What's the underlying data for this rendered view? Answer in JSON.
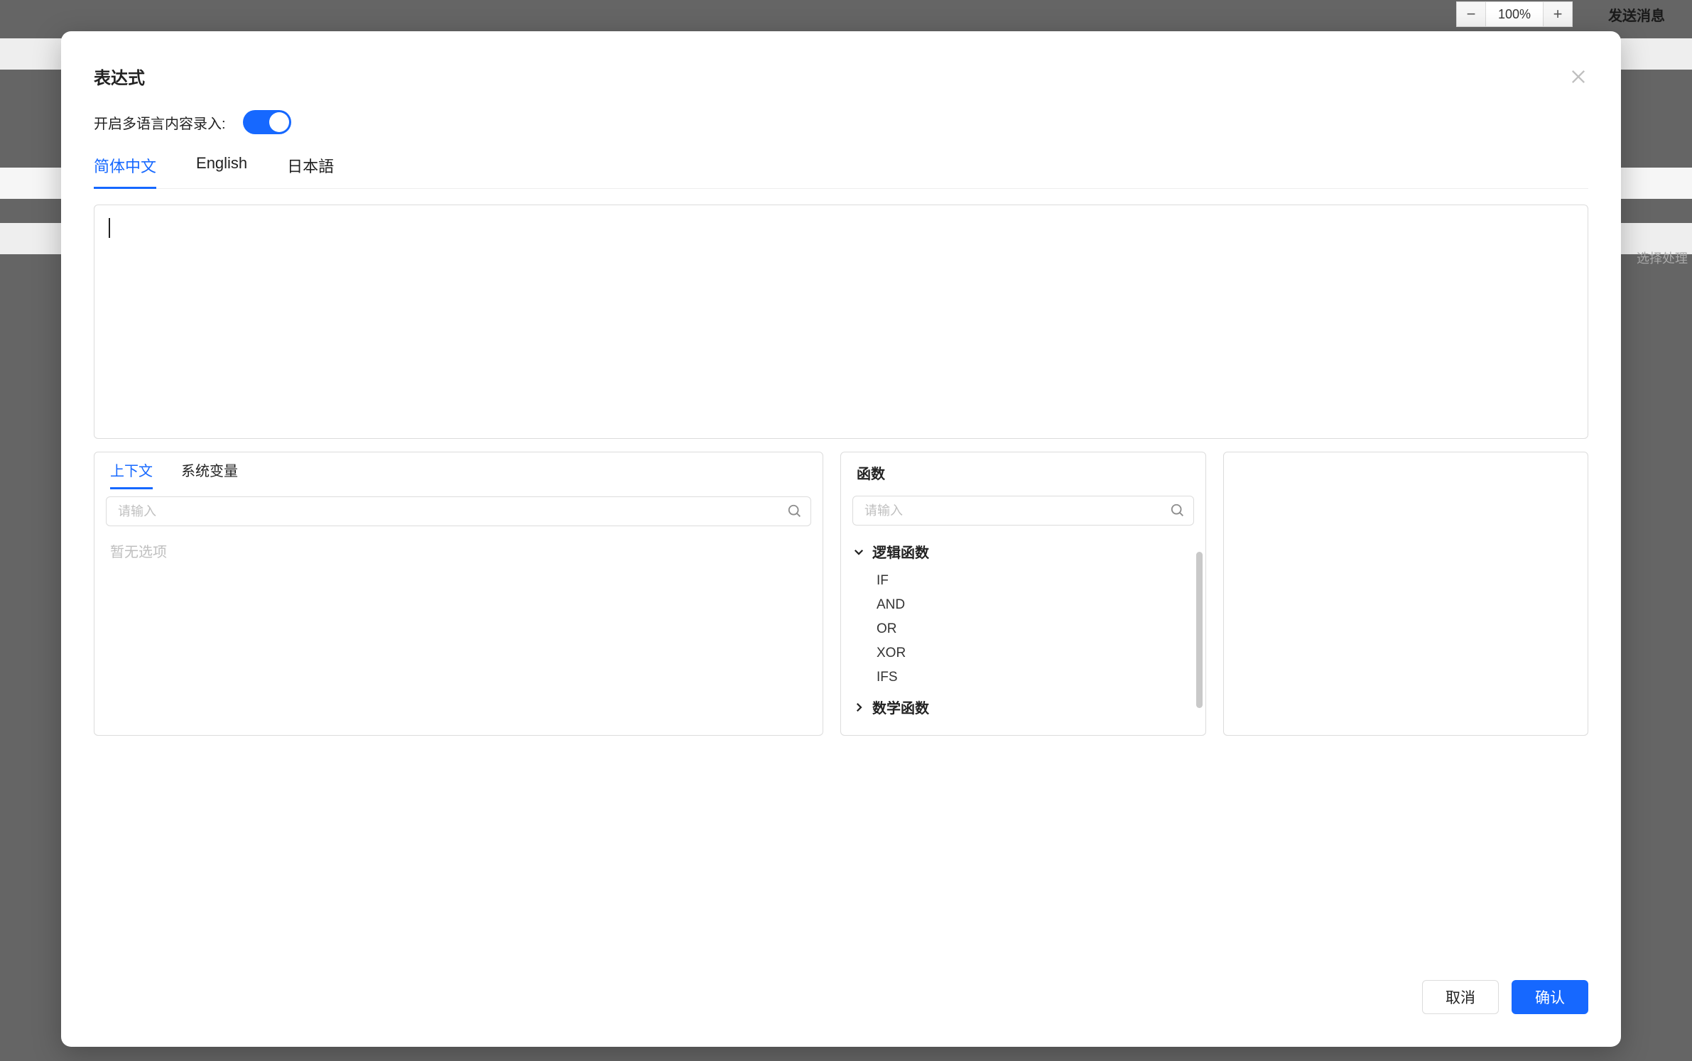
{
  "background": {
    "zoom_minus": "−",
    "zoom_value": "100%",
    "zoom_plus": "+",
    "send_msg": "发送消息",
    "side_hint": "选择处理"
  },
  "modal": {
    "title": "表达式",
    "multilang_label": "开启多语言内容录入:",
    "lang_tabs": [
      {
        "label": "简体中文",
        "active": true
      },
      {
        "label": "English",
        "active": false
      },
      {
        "label": "日本語",
        "active": false
      }
    ],
    "expression_value": "",
    "context": {
      "tabs": [
        {
          "label": "上下文",
          "active": true
        },
        {
          "label": "系统变量",
          "active": false
        }
      ],
      "search_placeholder": "请输入",
      "empty": "暂无选项"
    },
    "functions": {
      "title": "函数",
      "search_placeholder": "请输入",
      "categories": [
        {
          "label": "逻辑函数",
          "expanded": true,
          "items": [
            "IF",
            "AND",
            "OR",
            "XOR",
            "IFS"
          ]
        },
        {
          "label": "数学函数",
          "expanded": false,
          "items": []
        }
      ]
    },
    "footer": {
      "cancel": "取消",
      "confirm": "确认"
    }
  }
}
